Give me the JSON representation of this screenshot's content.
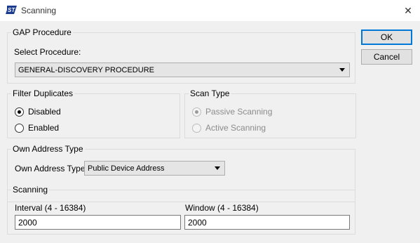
{
  "window": {
    "title": "Scanning",
    "logo_text": "ST",
    "close_glyph": "✕"
  },
  "gap_procedure": {
    "group_title": "GAP Procedure",
    "label": "Select Procedure:",
    "selected": "GENERAL-DISCOVERY PROCEDURE"
  },
  "filter_duplicates": {
    "group_title": "Filter Duplicates",
    "options": [
      {
        "label": "Disabled",
        "checked": true
      },
      {
        "label": "Enabled",
        "checked": false
      }
    ]
  },
  "scan_type": {
    "group_title": "Scan Type",
    "options": [
      {
        "label": "Passive Scanning",
        "checked": true,
        "disabled": true
      },
      {
        "label": "Active Scanning",
        "checked": false,
        "disabled": true
      }
    ]
  },
  "own_address": {
    "group_title": "Own Address Type",
    "label": "Own Address Type:",
    "selected": "Public Device Address"
  },
  "scanning": {
    "group_title": "Scanning",
    "interval_label": "Interval (4 - 16384)",
    "interval_value": "2000",
    "window_label": "Window (4 - 16384)",
    "window_value": "2000"
  },
  "buttons": {
    "ok": "OK",
    "cancel": "Cancel"
  },
  "colors": {
    "logo": "#1a3a8f",
    "default_button_border": "#0078d7",
    "client_background": "#f0f0f0"
  },
  "icons": {
    "app": "st-logo-icon",
    "close": "close-icon",
    "dropdown": "chevron-down-icon"
  }
}
